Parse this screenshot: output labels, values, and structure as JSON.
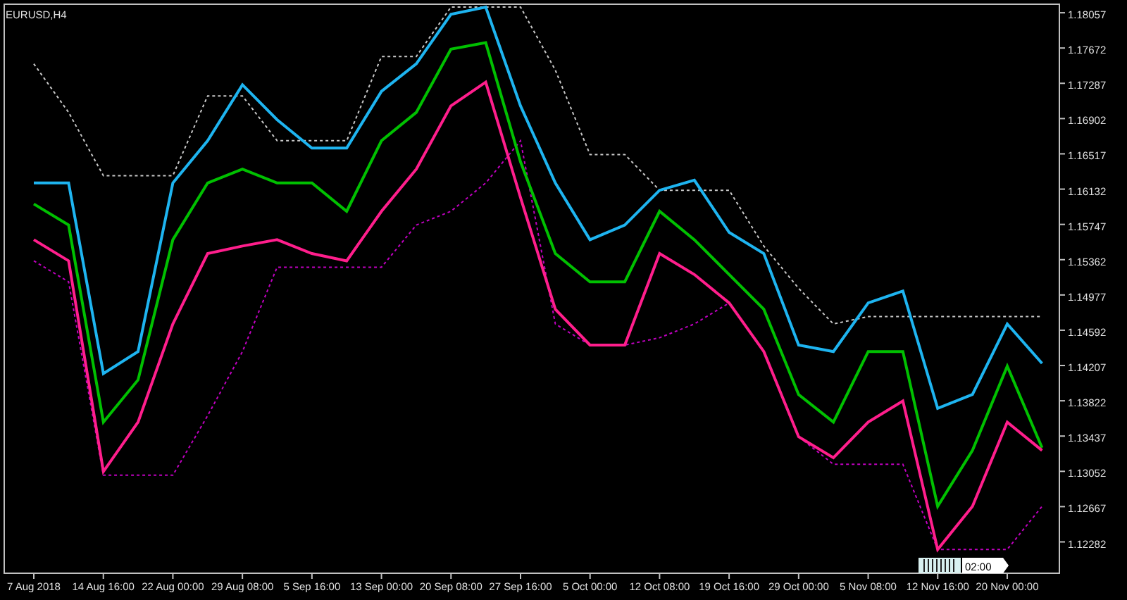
{
  "chart": {
    "symbol_label": "EURUSD,H4",
    "time_label": "02:00",
    "chart_data": {
      "type": "line",
      "categories": [
        "7 Aug 2018",
        null,
        "14 Aug 16:00",
        null,
        "22 Aug 00:00",
        null,
        "29 Aug 08:00",
        null,
        "5 Sep 16:00",
        null,
        "13 Sep 00:00",
        null,
        "20 Sep 08:00",
        null,
        "27 Sep 16:00",
        null,
        "5 Oct 00:00",
        null,
        "12 Oct 08:00",
        null,
        "19 Oct 16:00",
        null,
        "29 Oct 00:00",
        null,
        "5 Nov 08:00",
        null,
        "12 Nov 16:00",
        null,
        "20 Nov 00:00",
        null
      ],
      "ylim": [
        1.1194,
        1.1815
      ],
      "yticks": [
        1.18057,
        1.17672,
        1.17287,
        1.16902,
        1.16517,
        1.16132,
        1.15747,
        1.15362,
        1.14977,
        1.14592,
        1.14207,
        1.13822,
        1.13437,
        1.13052,
        1.12667,
        1.12282
      ],
      "series": [
        {
          "color": "#c8c8c8",
          "line_style": "dashed",
          "values": [
            1.175,
            1.1697,
            1.1628,
            1.1628,
            1.1628,
            1.1715,
            1.1715,
            1.1666,
            1.1666,
            1.1666,
            1.1758,
            1.1758,
            1.1812,
            1.1812,
            1.1812,
            1.1743,
            1.1651,
            1.1651,
            1.1612,
            1.1612,
            1.1612,
            1.1551,
            1.1505,
            1.1466,
            1.1474,
            1.1474,
            1.1474,
            1.1474,
            1.1474,
            1.1474
          ]
        },
        {
          "color": "#c000c0",
          "line_style": "dashed",
          "values": [
            1.1535,
            1.1512,
            1.1301,
            1.1301,
            1.1301,
            1.1366,
            1.1436,
            1.1528,
            1.1528,
            1.1528,
            1.1528,
            1.1574,
            1.1589,
            1.162,
            1.1666,
            1.1466,
            1.1443,
            1.1443,
            1.1451,
            1.1466,
            1.1489,
            1.1436,
            1.1343,
            1.1313,
            1.1313,
            1.1313,
            1.122,
            1.122,
            1.122,
            1.1267
          ]
        },
        {
          "color": "#00c000",
          "line_style": "solid",
          "values": [
            1.1597,
            1.1574,
            1.1359,
            1.1405,
            1.1558,
            1.162,
            1.1635,
            1.162,
            1.162,
            1.1589,
            1.1666,
            1.1697,
            1.1766,
            1.1773,
            1.1643,
            1.1543,
            1.1512,
            1.1512,
            1.1589,
            1.1558,
            1.152,
            1.1482,
            1.1389,
            1.1359,
            1.1436,
            1.1436,
            1.1267,
            1.1328,
            1.142,
            1.1331
          ]
        },
        {
          "color": "#1eb4f0",
          "line_style": "solid",
          "values": [
            1.162,
            1.162,
            1.1412,
            1.1436,
            1.162,
            1.1666,
            1.1727,
            1.1689,
            1.1658,
            1.1658,
            1.172,
            1.175,
            1.1804,
            1.1812,
            1.1704,
            1.162,
            1.1558,
            1.1574,
            1.1612,
            1.1623,
            1.1566,
            1.1543,
            1.1443,
            1.1436,
            1.1489,
            1.1502,
            1.1374,
            1.1389,
            1.1466,
            1.1423
          ]
        },
        {
          "color": "#ff1e8c",
          "line_style": "solid",
          "values": [
            1.1558,
            1.1535,
            1.1305,
            1.1359,
            1.1466,
            1.1543,
            1.1551,
            1.1558,
            1.1543,
            1.1535,
            1.1589,
            1.1635,
            1.1704,
            1.173,
            1.1604,
            1.1482,
            1.1443,
            1.1443,
            1.1543,
            1.152,
            1.1489,
            1.1436,
            1.1343,
            1.132,
            1.1359,
            1.1382,
            1.122,
            1.1267,
            1.1359,
            1.1328
          ]
        }
      ]
    }
  }
}
